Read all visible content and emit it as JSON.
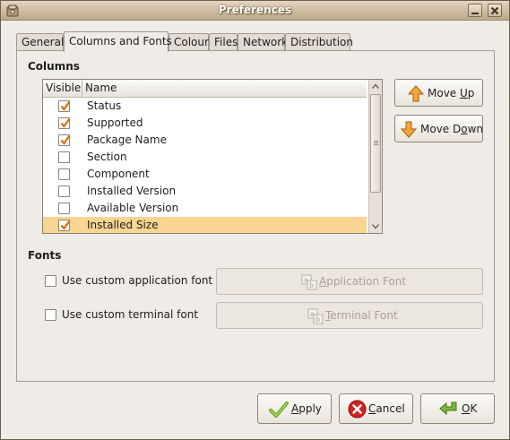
{
  "window": {
    "title": "Preferences"
  },
  "tabs": [
    {
      "label": "General"
    },
    {
      "label": "Columns and Fonts",
      "active": true
    },
    {
      "label": "Colour"
    },
    {
      "label": "Files"
    },
    {
      "label": "Network"
    },
    {
      "label": "Distribution"
    }
  ],
  "columns": {
    "section_label": "Columns",
    "headers": {
      "visible": "Visible",
      "name": "Name"
    },
    "rows": [
      {
        "name": "Status",
        "visible": true
      },
      {
        "name": "Supported",
        "visible": true
      },
      {
        "name": "Package Name",
        "visible": true
      },
      {
        "name": "Section",
        "visible": false
      },
      {
        "name": "Component",
        "visible": false
      },
      {
        "name": "Installed Version",
        "visible": false
      },
      {
        "name": "Available Version",
        "visible": false
      },
      {
        "name": "Installed Size",
        "visible": true,
        "selected": true
      }
    ],
    "move_up": {
      "pre": "Move ",
      "mnemonic": "U",
      "post": "p"
    },
    "move_down": {
      "pre": "Move D",
      "mnemonic": "o",
      "post": "wn"
    }
  },
  "fonts": {
    "section_label": "Fonts",
    "app_font_check": "Use custom application font",
    "app_font_button": {
      "mnemonic": "A",
      "post": "pplication Font"
    },
    "terminal_font_check": "Use custom terminal font",
    "terminal_font_button": {
      "mnemonic": "T",
      "post": "erminal Font"
    }
  },
  "dialog_buttons": {
    "apply": {
      "mnemonic": "A",
      "post": "pply"
    },
    "cancel": {
      "mnemonic": "C",
      "post": "ancel"
    },
    "ok": {
      "mnemonic": "O",
      "post": "K"
    }
  },
  "colors": {
    "selection": "#f9d492",
    "check_orange": "#e46a00",
    "titlebar": "#cdbba0"
  },
  "icons": {
    "window": "preferences-icon",
    "move_up": "arrow-up-icon",
    "move_down": "arrow-down-icon",
    "font": "font-icon",
    "apply": "checkmark-icon",
    "cancel": "cancel-icon",
    "ok": "ok-arrow-icon"
  }
}
